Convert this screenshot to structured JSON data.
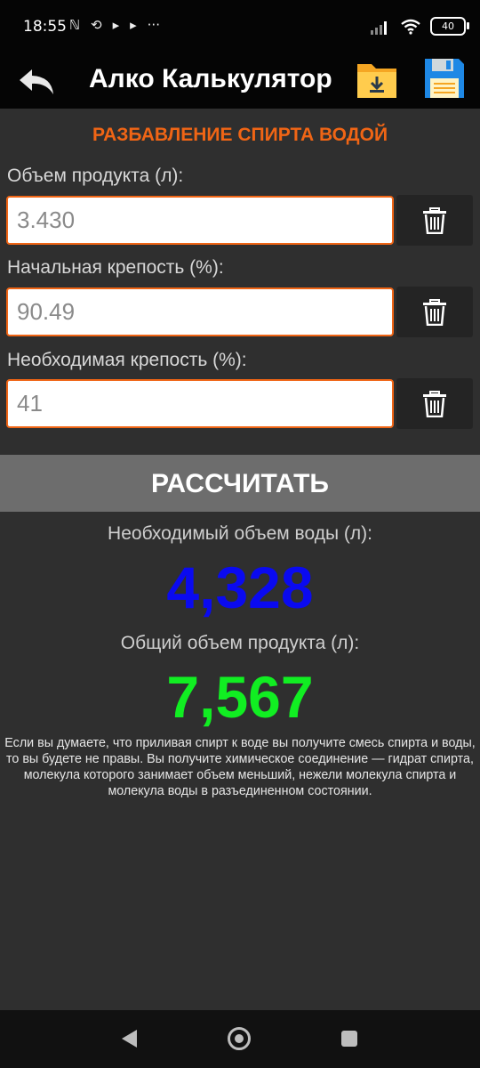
{
  "status_bar": {
    "time": "18:55",
    "notif_icons": [
      "nfc-icon",
      "sync-icon",
      "play-icon",
      "play-icon"
    ],
    "more": "···",
    "battery": "40"
  },
  "app_bar": {
    "title": "Алко Калькулятор",
    "icons": [
      "back-arrow-icon",
      "folder-download-icon",
      "floppy-disk-icon"
    ]
  },
  "form": {
    "section_title": "РАЗБАВЛЕНИЕ СПИРТА ВОДОЙ",
    "fields": [
      {
        "label": "Объем продукта (л):",
        "value": "3.430"
      },
      {
        "label": "Начальная крепость (%):",
        "value": "90.49"
      },
      {
        "label": "Необходимая крепость (%):",
        "value": "41"
      }
    ]
  },
  "calculate_label": "РАССЧИТАТЬ",
  "results": {
    "water_label": "Необходимый объем воды (л):",
    "water_value": "4,328",
    "total_label": "Общий объем продукта (л):",
    "total_value": "7,567"
  },
  "note": "Если вы думаете, что приливая спирт к воде вы получите смесь спирта и воды, то вы будете не правы. Вы получите химическое соединение — гидрат спирта, молекула которого занимает объем меньший, нежели молекула спирта и молекула воды в разъединенном состоянии.",
  "colors": {
    "accent": "#f06515",
    "water_value": "#0a0af0",
    "total_value": "#11ee22"
  }
}
